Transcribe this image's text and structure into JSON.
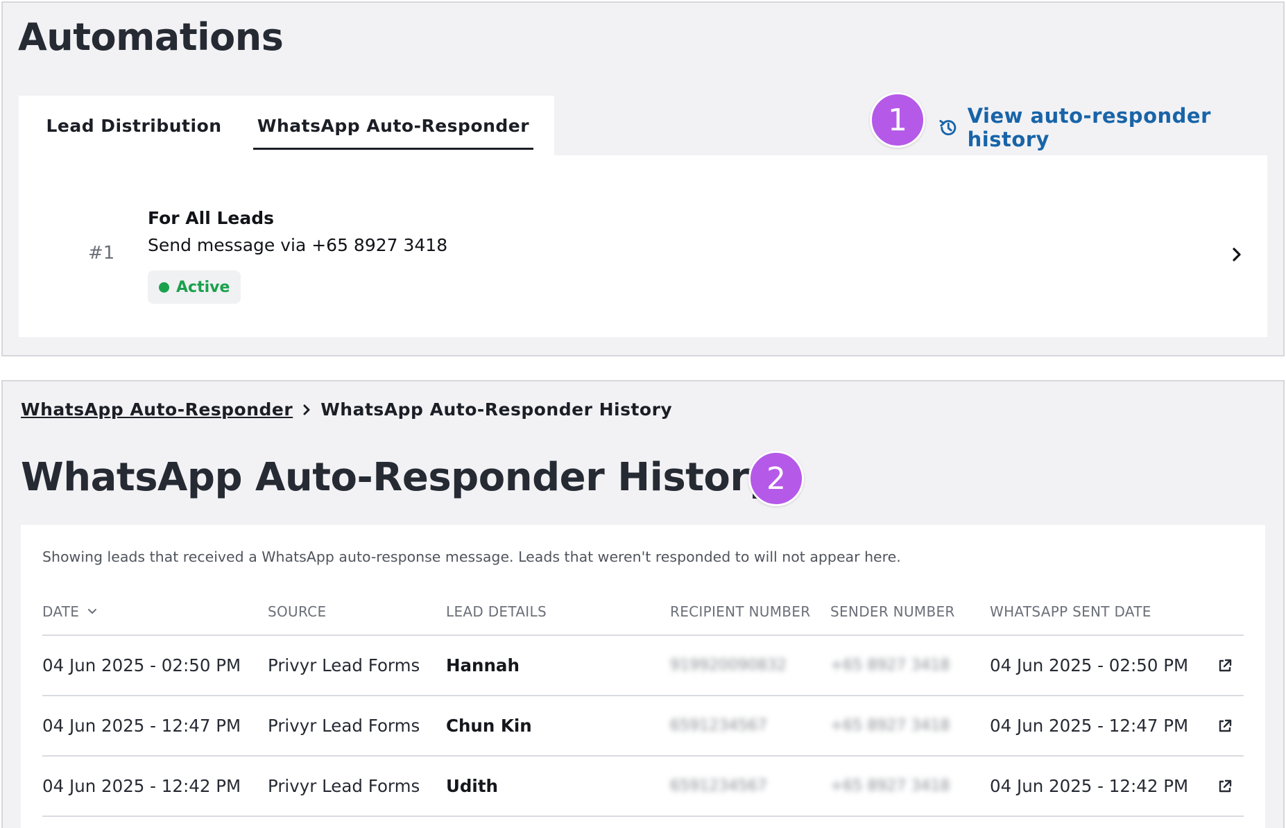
{
  "automations": {
    "title": "Automations",
    "tabs": [
      {
        "label": "Lead Distribution"
      },
      {
        "label": "WhatsApp Auto-Responder",
        "active": true
      }
    ],
    "history_link": {
      "label": "View auto-responder history",
      "icon": "history-icon"
    },
    "callout_1": "1",
    "rule": {
      "number": "#1",
      "title": "For All Leads",
      "subtitle": "Send message via +65 8927 3418",
      "status": "Active",
      "status_color": "#1aa14c"
    }
  },
  "history": {
    "breadcrumb": {
      "parent": "WhatsApp Auto-Responder",
      "current": "WhatsApp Auto-Responder History"
    },
    "title": "WhatsApp Auto-Responder History",
    "callout_2": "2",
    "description": "Showing leads that received a WhatsApp auto-response message. Leads that weren't responded to will not appear here.",
    "columns": [
      "DATE",
      "SOURCE",
      "LEAD DETAILS",
      "RECIPIENT NUMBER",
      "SENDER NUMBER",
      "WHATSAPP SENT DATE"
    ],
    "rows": [
      {
        "date": "04 Jun 2025 - 02:50 PM",
        "source": "Privyr Lead Forms",
        "lead": "Hannah",
        "recipient": "919920090832",
        "sender": "+65 8927 3418",
        "sent_date": "04 Jun 2025 - 02:50 PM"
      },
      {
        "date": "04 Jun 2025 - 12:47 PM",
        "source": "Privyr Lead Forms",
        "lead": "Chun Kin",
        "recipient": "6591234567",
        "sender": "+65 8927 3418",
        "sent_date": "04 Jun 2025 - 12:47 PM"
      },
      {
        "date": "04 Jun 2025 - 12:42 PM",
        "source": "Privyr Lead Forms",
        "lead": "Udith",
        "recipient": "6591234567",
        "sender": "+65 8927 3418",
        "sent_date": "04 Jun 2025 - 12:42 PM"
      }
    ]
  },
  "colors": {
    "accent_link": "#1864a8",
    "callout_badge": "#b55ae8",
    "panel_bg": "#f2f2f5"
  }
}
